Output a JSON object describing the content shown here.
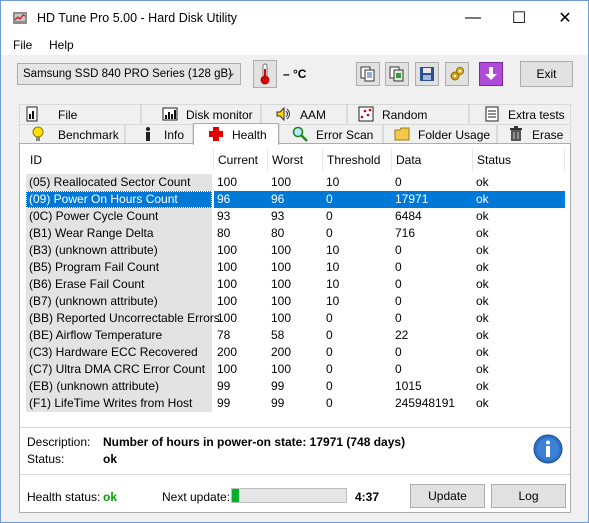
{
  "window": {
    "title": "HD Tune Pro 5.00 - Hard Disk Utility",
    "minimize_glyph": "—",
    "maximize_glyph": "☐",
    "close_glyph": "✕"
  },
  "menu": {
    "file": "File",
    "help": "Help"
  },
  "toolbar": {
    "drive": "Samsung SSD 840 PRO Series (128 gB)",
    "temperature": "– °C",
    "exit_label": "Exit",
    "icons": [
      "thermometer-icon",
      "copy-icon",
      "copy-info-icon",
      "save-icon",
      "options-icon",
      "download-icon"
    ]
  },
  "tabs": {
    "row1": [
      "File Benchmark",
      "Disk monitor",
      "AAM",
      "Random Access",
      "Extra tests"
    ],
    "row2": [
      "Benchmark",
      "Info",
      "Health",
      "Error Scan",
      "Folder Usage",
      "Erase"
    ],
    "active": "Health"
  },
  "table": {
    "headers": [
      "ID",
      "Current",
      "Worst",
      "Threshold",
      "Data",
      "Status"
    ],
    "selected_row": 1,
    "rows": [
      [
        "(05) Reallocated Sector Count",
        "100",
        "100",
        "10",
        "0",
        "ok"
      ],
      [
        "(09) Power On Hours Count",
        "96",
        "96",
        "0",
        "17971",
        "ok"
      ],
      [
        "(0C) Power Cycle Count",
        "93",
        "93",
        "0",
        "6484",
        "ok"
      ],
      [
        "(B1) Wear Range Delta",
        "80",
        "80",
        "0",
        "716",
        "ok"
      ],
      [
        "(B3) (unknown attribute)",
        "100",
        "100",
        "10",
        "0",
        "ok"
      ],
      [
        "(B5) Program Fail Count",
        "100",
        "100",
        "10",
        "0",
        "ok"
      ],
      [
        "(B6) Erase Fail Count",
        "100",
        "100",
        "10",
        "0",
        "ok"
      ],
      [
        "(B7) (unknown attribute)",
        "100",
        "100",
        "10",
        "0",
        "ok"
      ],
      [
        "(BB) Reported Uncorrectable Errors",
        "100",
        "100",
        "0",
        "0",
        "ok"
      ],
      [
        "(BE) Airflow Temperature",
        "78",
        "58",
        "0",
        "22",
        "ok"
      ],
      [
        "(C3) Hardware ECC Recovered",
        "200",
        "200",
        "0",
        "0",
        "ok"
      ],
      [
        "(C7) Ultra DMA CRC Error Count",
        "100",
        "100",
        "0",
        "0",
        "ok"
      ],
      [
        "(EB) (unknown attribute)",
        "99",
        "99",
        "0",
        "1015",
        "ok"
      ],
      [
        "(F1) LifeTime Writes from Host",
        "99",
        "99",
        "0",
        "245948191",
        "ok"
      ]
    ]
  },
  "details": {
    "description_label": "Description:",
    "description_value": "Number of hours in power-on state: 17971 (748 days)",
    "status_label": "Status:",
    "status_value": "ok"
  },
  "footer": {
    "health_label": "Health status:",
    "health_value": "ok",
    "health_color": "#00a000",
    "next_update_label": "Next update:",
    "progress_fraction": 0.06,
    "countdown": "4:37",
    "update_label": "Update",
    "log_label": "Log"
  }
}
